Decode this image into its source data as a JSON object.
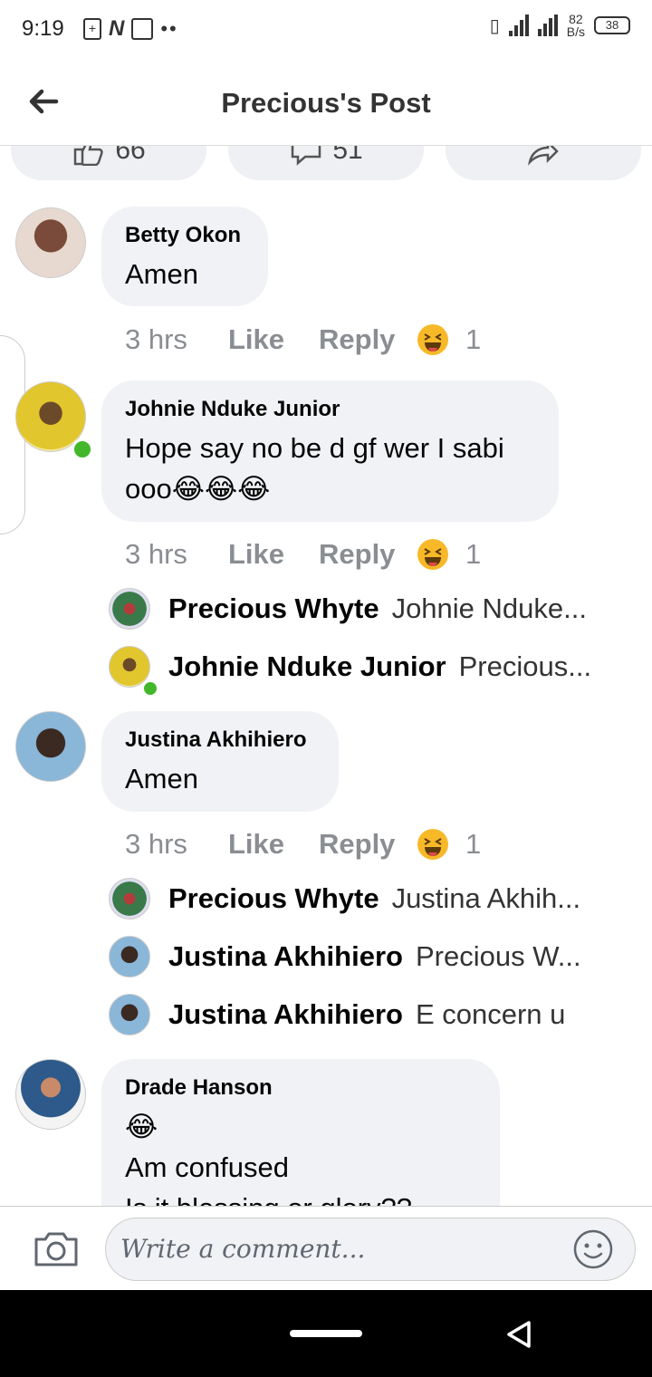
{
  "status_bar": {
    "time": "9:19",
    "net_speed": "82",
    "net_unit": "B/s",
    "battery": "38"
  },
  "header": {
    "title": "Precious's Post"
  },
  "reaction_bar": {
    "likes": "66",
    "comments": "51"
  },
  "comments": [
    {
      "name": "Betty Okon",
      "text": "Amen",
      "time": "3 hrs",
      "like": "Like",
      "reply": "Reply",
      "reaction_count": "1"
    },
    {
      "name": "Johnie Nduke Junior",
      "text": "Hope say no be d gf wer I sabi ooo😂😂😂",
      "time": "3 hrs",
      "like": "Like",
      "reply": "Reply",
      "reaction_count": "1",
      "replies": [
        {
          "name": "Precious Whyte",
          "text": "Johnie Nduke..."
        },
        {
          "name": "Johnie Nduke Junior",
          "text": "Precious..."
        }
      ]
    },
    {
      "name": "Justina Akhihiero",
      "text": "Amen",
      "time": "3 hrs",
      "like": "Like",
      "reply": "Reply",
      "reaction_count": "1",
      "replies": [
        {
          "name": "Precious Whyte",
          "text": "Justina Akhih..."
        },
        {
          "name": "Justina Akhihiero",
          "text": "Precious W..."
        },
        {
          "name": "Justina Akhihiero",
          "text": "E concern u"
        }
      ]
    },
    {
      "name": "Drade Hanson",
      "emoji": "😂",
      "text": "Am confused",
      "text_cut": "Is it blessing or glory??"
    }
  ],
  "composer": {
    "placeholder": "Write a comment..."
  },
  "colors": {
    "bubble": "#f0f2f5",
    "online": "#42b72a",
    "muted": "#8a8d91"
  }
}
